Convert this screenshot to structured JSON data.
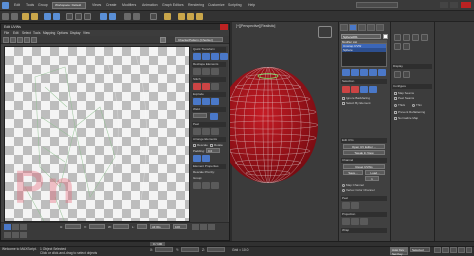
{
  "app": {
    "menu": [
      "Edit",
      "Tools",
      "Group",
      "Views",
      "Create",
      "Modifiers",
      "Animation",
      "Graph Editors",
      "Rendering",
      "Customize",
      "Scripting",
      "Help"
    ],
    "workspace_label": "Workspace: Default"
  },
  "viewport": {
    "label": "[+][Perspective][Realistic]"
  },
  "uv_editor": {
    "title": "Edit UVWs",
    "menu": [
      "File",
      "Edit",
      "Select",
      "Tools",
      "Mapping",
      "Options",
      "Display",
      "View"
    ],
    "map_dropdown": "CheckerPattern (Checker)",
    "headers": {
      "quick_transform": "Quick Transform",
      "reshape": "Reshape Elements",
      "stitch": "Stitch",
      "explode": "Explode",
      "weld": "Weld",
      "peel": "Peel",
      "arrange": "Arrange Elements",
      "element_props": "Element Properties"
    },
    "rescale_label": "Rescale",
    "rotate_label": "Rotate",
    "padding_label": "Padding:",
    "padding_value": "0.0",
    "group_label": "Group:",
    "rescale_priority": "Rescale Priority:",
    "bottom": {
      "u_label": "U:",
      "v_label": "V:",
      "w_label": "W:",
      "l_label": "L:",
      "all_ids": "All IDs",
      "zoom": "100"
    }
  },
  "command_panel": {
    "object_name": "Sphere001",
    "modifier_list_label": "Modifier List",
    "modifiers": [
      "Unwrap UVW",
      "Sphere"
    ],
    "rollouts": {
      "selection": "Selection",
      "edit_uvs": "Edit UVs",
      "channel": "Channel",
      "peel": "Peel",
      "projection": "Projection",
      "wrap": "Wrap",
      "configure": "Configure"
    },
    "buttons": {
      "open_editor": "Open UV Editor ...",
      "tweak": "Tweak In View",
      "reset": "Reset UVWs",
      "save": "Save...",
      "load": "Load...",
      "channel_value": "1"
    },
    "channel_options": [
      "Map Channel",
      "Vertex Color Channel"
    ],
    "selection_options": [
      "Ignore Backfacing",
      "Select By Element"
    ]
  },
  "right_panel": {
    "display_head": "Display",
    "configure_head": "Configure",
    "display_options": [
      "Map Seams",
      "Peel Seams",
      "Thick",
      "Thin",
      "Prevent Reflattening",
      "Normalize Map"
    ]
  },
  "status": {
    "selected": "1 Object Selected",
    "prompt": "Click or click-and-drag to select objects",
    "welcome": "Welcome to MAXScript.",
    "frame": "0 / 100",
    "x_label": "X:",
    "y_label": "Y:",
    "z_label": "Z:",
    "grid": "Grid = 10.0",
    "auto_key": "Auto Key",
    "set_key": "Set Key",
    "selected_dd": "Selected"
  },
  "colors": {
    "sphere": "#b3141c",
    "wire": "#e8e8e8",
    "accent": "#3b66b8",
    "close": "#b22222"
  },
  "watermark": "Pn"
}
